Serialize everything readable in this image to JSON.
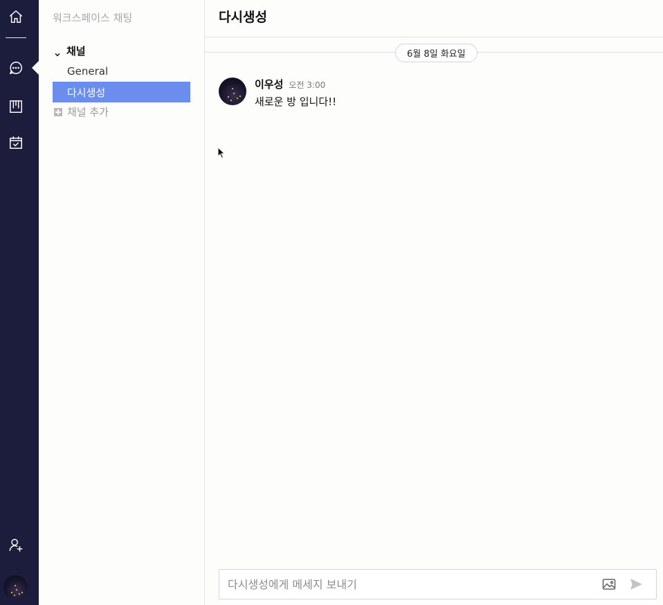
{
  "sidebar": {
    "workspace_title": "워크스페이스 채팅",
    "section_label": "채널",
    "channels": [
      {
        "label": "General",
        "active": false
      },
      {
        "label": "다시생성",
        "active": true
      }
    ],
    "add_channel_label": "채널 추가"
  },
  "rail": {
    "icons": [
      "home-icon",
      "chat-icon",
      "board-icon",
      "calendar-icon",
      "add-user-icon"
    ]
  },
  "main": {
    "title": "다시생성",
    "date_divider": "6월 8일 화요일",
    "messages": [
      {
        "author": "이우성",
        "time": "오전 3:00",
        "text": "새로운 방 입니다!!"
      }
    ],
    "composer": {
      "placeholder": "다시생성에게 메세지 보내기"
    }
  },
  "colors": {
    "rail_bg": "#1c1c3d",
    "active_channel": "#6b8ded"
  }
}
